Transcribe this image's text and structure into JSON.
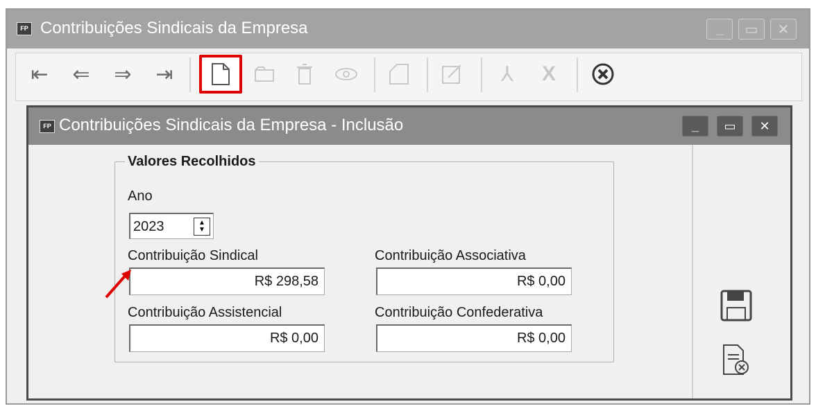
{
  "outer_window": {
    "logo": "FP",
    "title": "Contribuições Sindicais da Empresa",
    "controls": [
      "minimize",
      "maximize",
      "close"
    ]
  },
  "toolbar": {
    "icons": [
      {
        "name": "first-record-icon",
        "glyph": "⇤",
        "enabled": true
      },
      {
        "name": "previous-record-icon",
        "glyph": "⇐",
        "enabled": true
      },
      {
        "name": "next-record-icon",
        "glyph": "⇒",
        "enabled": true
      },
      {
        "name": "last-record-icon",
        "glyph": "⇥",
        "enabled": true
      },
      {
        "name": "new-record-icon",
        "glyph": "🗋",
        "enabled": true,
        "highlighted": true
      },
      {
        "name": "edit-record-icon",
        "glyph": "✎",
        "enabled": false
      },
      {
        "name": "delete-icon",
        "glyph": "🗑",
        "enabled": false
      },
      {
        "name": "view-icon",
        "glyph": "👁",
        "enabled": false
      },
      {
        "name": "copy-icon",
        "glyph": "◰",
        "enabled": false
      },
      {
        "name": "edit-icon",
        "glyph": "✎",
        "enabled": false
      },
      {
        "name": "pdf-icon",
        "glyph": "⅄",
        "enabled": false
      },
      {
        "name": "excel-icon",
        "glyph": "X",
        "enabled": false
      },
      {
        "name": "close-x-icon",
        "glyph": "✖",
        "enabled": true
      }
    ],
    "highlight_color": "#e00000"
  },
  "inner_window": {
    "logo": "FP",
    "title": "Contribuições Sindicais da Empresa - Inclusão",
    "group_title": "Valores Recolhidos",
    "ano_label": "Ano",
    "ano_value": "2023",
    "fields": {
      "sindical": {
        "label": "Contribuição Sindical",
        "value": "R$ 298,58"
      },
      "associativa": {
        "label": "Contribuição Associativa",
        "value": "R$ 0,00"
      },
      "assistencial": {
        "label": "Contribuição Assistencial",
        "value": "R$ 0,00"
      },
      "confederativa": {
        "label": "Contribuição Confederativa",
        "value": "R$ 0,00"
      }
    },
    "annotation_color": "#e00000"
  }
}
